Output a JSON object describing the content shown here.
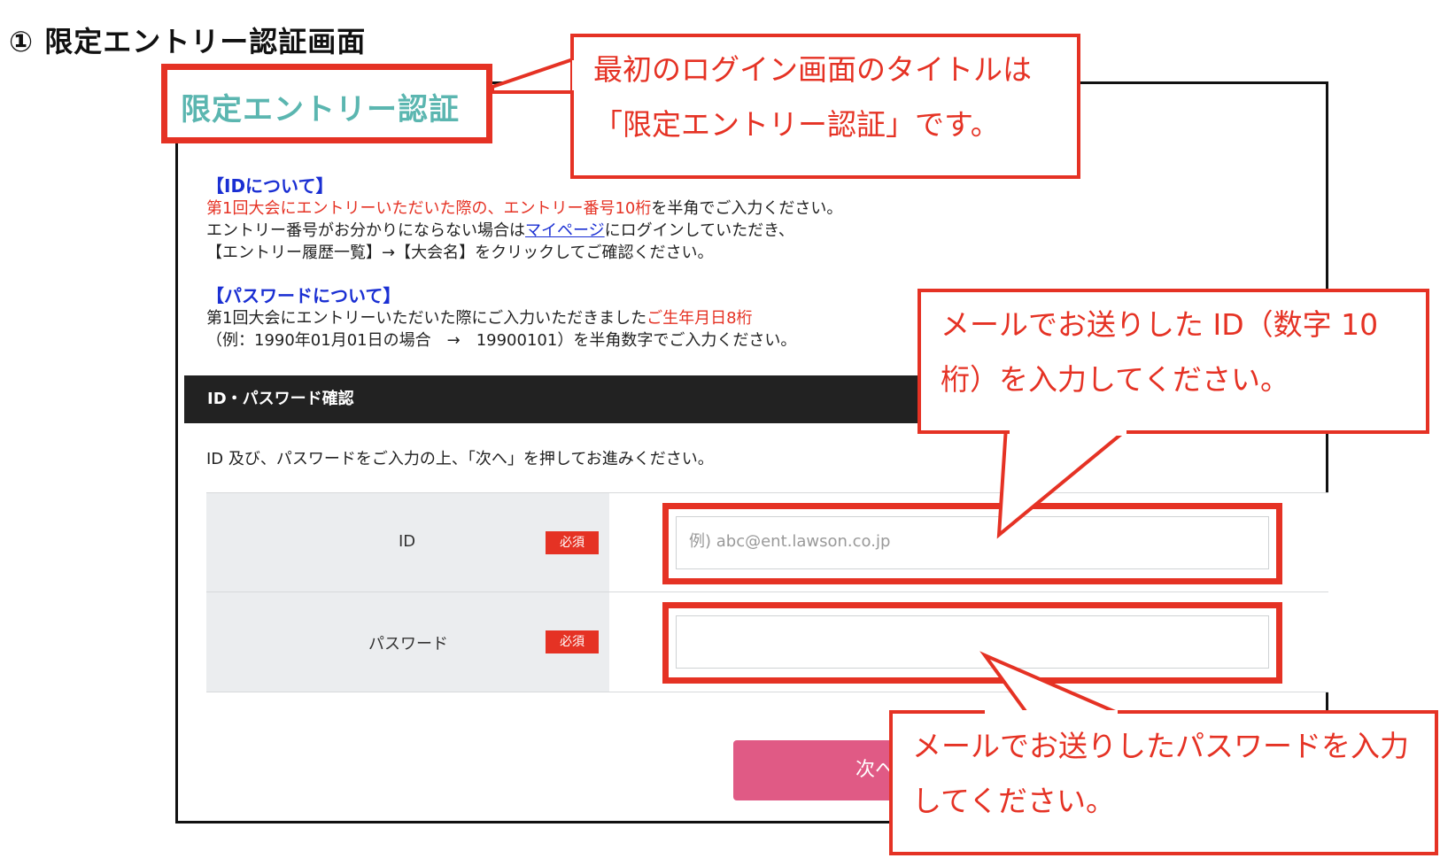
{
  "heading": "① 限定エントリー認証画面",
  "page_title": "限定エントリー認証",
  "callouts": {
    "title_note": "最初のログイン画面のタイトルは「限定エントリー認証」です。",
    "id_note": "メールでお送りした ID（数字 10 桁）を入力してください。",
    "password_note": "メールでお送りしたパスワードを入力してください。"
  },
  "id_info": {
    "heading": "【IDについて】",
    "line1_red": "第1回大会にエントリーいただいた際の、エントリー番号10桁",
    "line1_rest": "を半角でご入力ください。",
    "line2_pre": "エントリー番号がお分かりにならない場合は",
    "line2_link": "マイページ",
    "line2_post": "にログインしていただき、",
    "line3": "【エントリー履歴一覧】→【大会名】をクリックしてご確認ください。"
  },
  "password_info": {
    "heading": "【パスワードについて】",
    "line1_pre": "第1回大会にエントリーいただいた際にご入力いただきました",
    "line1_red": "ご生年月日8桁",
    "line2": "（例：1990年01月01日の場合　→　19900101）を半角数字でご入力ください。"
  },
  "section_title": "ID・パスワード確認",
  "instruction": "ID 及び、パスワードをご入力の上、「次へ」を押してお進みください。",
  "form": {
    "id_label": "ID",
    "password_label": "パスワード",
    "required_badge": "必須",
    "id_placeholder": "例) abc@ent.lawson.co.jp",
    "password_placeholder": ""
  },
  "next_button": "次へ",
  "colors": {
    "accent_red": "#e53224",
    "title_teal": "#5bb6b0",
    "link_blue": "#1a2fd3",
    "button_pink": "#e05a85"
  }
}
